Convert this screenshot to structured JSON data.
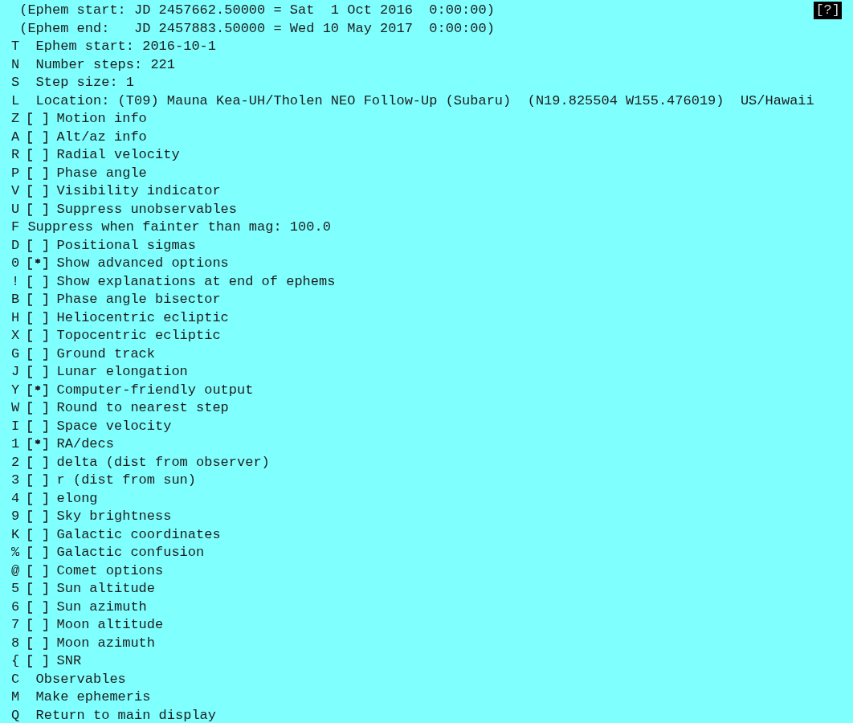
{
  "header_lines": [
    "(Ephem start: JD 2457662.50000 = Sat  1 Oct 2016  0:00:00)",
    "(Ephem end:   JD 2457883.50000 = Wed 10 May 2017  0:00:00)"
  ],
  "help_button": {
    "label": "[?]"
  },
  "items": [
    {
      "key": "T",
      "kind": "command",
      "label": "Ephem start: 2016-10-1"
    },
    {
      "key": "N",
      "kind": "command",
      "label": "Number steps: 221"
    },
    {
      "key": "S",
      "kind": "command",
      "label": "Step size: 1"
    },
    {
      "key": "L",
      "kind": "command",
      "label": "Location: (T09) Mauna Kea-UH/Tholen NEO Follow-Up (Subaru)  (N19.825504 W155.476019)  US/Hawaii"
    },
    {
      "key": "Z",
      "kind": "toggle",
      "checked": false,
      "label": "Motion info"
    },
    {
      "key": "A",
      "kind": "toggle",
      "checked": false,
      "label": "Alt/az info"
    },
    {
      "key": "R",
      "kind": "toggle",
      "checked": false,
      "label": "Radial velocity"
    },
    {
      "key": "P",
      "kind": "toggle",
      "checked": false,
      "label": "Phase angle"
    },
    {
      "key": "V",
      "kind": "toggle",
      "checked": false,
      "label": "Visibility indicator"
    },
    {
      "key": "U",
      "kind": "toggle",
      "checked": false,
      "label": "Suppress unobservables"
    },
    {
      "key": "F",
      "kind": "field",
      "label": "Suppress when fainter than mag: 100.0"
    },
    {
      "key": "D",
      "kind": "toggle",
      "checked": false,
      "label": "Positional sigmas"
    },
    {
      "key": "0",
      "kind": "toggle",
      "checked": true,
      "label": "Show advanced options"
    },
    {
      "key": "!",
      "kind": "toggle",
      "checked": false,
      "label": "Show explanations at end of ephems"
    },
    {
      "key": "B",
      "kind": "toggle",
      "checked": false,
      "label": "Phase angle bisector"
    },
    {
      "key": "H",
      "kind": "toggle",
      "checked": false,
      "label": "Heliocentric ecliptic"
    },
    {
      "key": "X",
      "kind": "toggle",
      "checked": false,
      "label": "Topocentric ecliptic"
    },
    {
      "key": "G",
      "kind": "toggle",
      "checked": false,
      "label": "Ground track"
    },
    {
      "key": "J",
      "kind": "toggle",
      "checked": false,
      "label": "Lunar elongation"
    },
    {
      "key": "Y",
      "kind": "toggle",
      "checked": true,
      "label": "Computer-friendly output"
    },
    {
      "key": "W",
      "kind": "toggle",
      "checked": false,
      "label": "Round to nearest step"
    },
    {
      "key": "I",
      "kind": "toggle",
      "checked": false,
      "label": "Space velocity"
    },
    {
      "key": "1",
      "kind": "toggle",
      "checked": true,
      "label": "RA/decs"
    },
    {
      "key": "2",
      "kind": "toggle",
      "checked": false,
      "label": "delta (dist from observer)"
    },
    {
      "key": "3",
      "kind": "toggle",
      "checked": false,
      "label": "r (dist from sun)"
    },
    {
      "key": "4",
      "kind": "toggle",
      "checked": false,
      "label": "elong"
    },
    {
      "key": "9",
      "kind": "toggle",
      "checked": false,
      "label": "Sky brightness"
    },
    {
      "key": "K",
      "kind": "toggle",
      "checked": false,
      "label": "Galactic coordinates"
    },
    {
      "key": "%",
      "kind": "toggle",
      "checked": false,
      "label": "Galactic confusion"
    },
    {
      "key": "@",
      "kind": "toggle",
      "checked": false,
      "label": "Comet options"
    },
    {
      "key": "5",
      "kind": "toggle",
      "checked": false,
      "label": "Sun altitude"
    },
    {
      "key": "6",
      "kind": "toggle",
      "checked": false,
      "label": "Sun azimuth"
    },
    {
      "key": "7",
      "kind": "toggle",
      "checked": false,
      "label": "Moon altitude"
    },
    {
      "key": "8",
      "kind": "toggle",
      "checked": false,
      "label": "Moon azimuth"
    },
    {
      "key": "{",
      "kind": "toggle",
      "checked": false,
      "label": "SNR"
    },
    {
      "key": "C",
      "kind": "command",
      "label": "Observables"
    },
    {
      "key": "M",
      "kind": "command",
      "label": "Make ephemeris"
    },
    {
      "key": "Q",
      "kind": "command",
      "label": "Return to main display"
    }
  ]
}
